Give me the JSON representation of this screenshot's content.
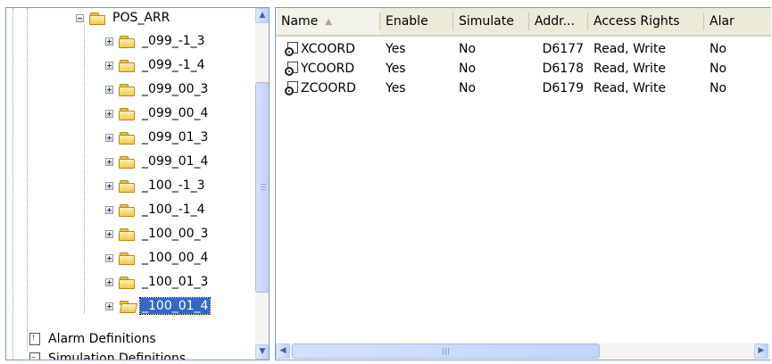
{
  "tree": {
    "root_folder": "POS_ARR",
    "children": [
      {
        "label": "_099_-1_3",
        "selected": false
      },
      {
        "label": "_099_-1_4",
        "selected": false
      },
      {
        "label": "_099_00_3",
        "selected": false
      },
      {
        "label": "_099_00_4",
        "selected": false
      },
      {
        "label": "_099_01_3",
        "selected": false
      },
      {
        "label": "_099_01_4",
        "selected": false
      },
      {
        "label": "_100_-1_3",
        "selected": false
      },
      {
        "label": "_100_-1_4",
        "selected": false
      },
      {
        "label": "_100_00_3",
        "selected": false
      },
      {
        "label": "_100_00_4",
        "selected": false
      },
      {
        "label": "_100_01_3",
        "selected": false
      },
      {
        "label": "_100_01_4",
        "selected": true
      }
    ],
    "bottom_items": [
      {
        "label": "Alarm Definitions",
        "icon": "alarm-definitions-icon"
      },
      {
        "label": "Simulation Definitions",
        "icon": "simulation-definitions-icon"
      }
    ]
  },
  "list": {
    "columns": [
      {
        "label": "Name",
        "sorted": true
      },
      {
        "label": "Enable"
      },
      {
        "label": "Simulate"
      },
      {
        "label": "Addr..."
      },
      {
        "label": "Access Rights"
      },
      {
        "label": "Alar"
      }
    ],
    "rows": [
      {
        "name": "XCOORD",
        "enable": "Yes",
        "simulate": "No",
        "address": "D6177",
        "access": "Read, Write",
        "alarm": "No"
      },
      {
        "name": "YCOORD",
        "enable": "Yes",
        "simulate": "No",
        "address": "D6178",
        "access": "Read, Write",
        "alarm": "No"
      },
      {
        "name": "ZCOORD",
        "enable": "Yes",
        "simulate": "No",
        "address": "D6179",
        "access": "Read, Write",
        "alarm": "No"
      }
    ]
  }
}
